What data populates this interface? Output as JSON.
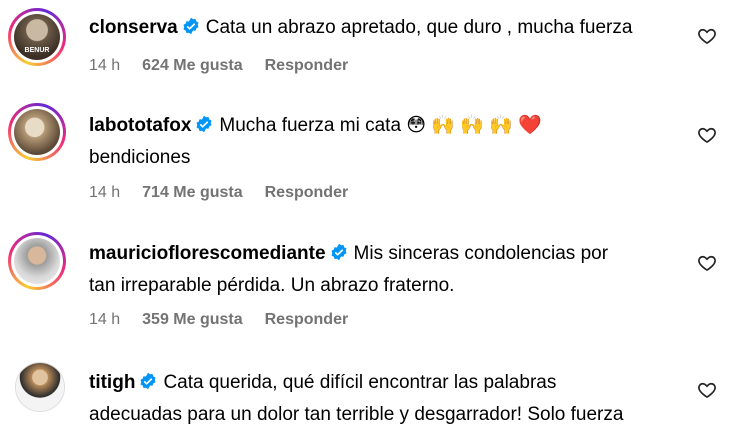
{
  "comments": [
    {
      "username": "clonserva",
      "line1": "Cata un abrazo apretado, que duro , mucha fuerza",
      "line2": "",
      "time": "14 h",
      "likes": "624 Me gusta",
      "reply": "Responder",
      "avatar_caption": "BENUR"
    },
    {
      "username": "labototafox",
      "line1": "Mucha fuerza mi cata 😳 🙌 🙌 🙌 ❤️",
      "line2": "bendiciones",
      "time": "14 h",
      "likes": "714 Me gusta",
      "reply": "Responder"
    },
    {
      "username": "mauricioflorescomediante",
      "line1": "Mis sinceras condolencias por",
      "line2": "tan irreparable pérdida. Un abrazo fraterno.",
      "time": "14 h",
      "likes": "359 Me gusta",
      "reply": "Responder"
    },
    {
      "username": "titigh",
      "line1": "Cata querida, qué difícil encontrar las palabras",
      "line2": "adecuadas para un dolor tan terrible y desgarrador! Solo fuerza",
      "time": "",
      "likes": "",
      "reply": ""
    }
  ],
  "colors": {
    "verified": "#0095f6",
    "muted": "#737373"
  }
}
